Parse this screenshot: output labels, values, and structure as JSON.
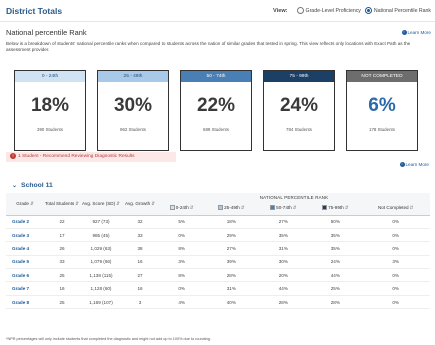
{
  "header": {
    "title": "District Totals",
    "view_label": "View:",
    "view_options": [
      {
        "label": "Grade-Level Proficiency",
        "selected": false
      },
      {
        "label": "National Percentile Rank",
        "selected": true
      }
    ]
  },
  "section": {
    "title": "National percentile Rank",
    "learn_more": "Learn More",
    "description": "Below is a breakdown of students' national percentile ranks when compared to students across the nation of similar grades that tested in spring. This view reflects only locations with Exact Path as the assessment provider."
  },
  "cards": [
    {
      "label": "0 - 24th",
      "percent": "18%",
      "count": "390 Students",
      "head_bg": "#cfe3f5",
      "head_color": "#1f4e79",
      "pct_color": "#3a3a3a"
    },
    {
      "label": "25 - 49th",
      "percent": "30%",
      "count": "962 Students",
      "head_bg": "#a9c9e8",
      "head_color": "#1f4e79",
      "pct_color": "#3a3a3a"
    },
    {
      "label": "50 - 74th",
      "percent": "22%",
      "count": "689 Students",
      "head_bg": "#4a7fb5",
      "head_color": "#ffffff",
      "pct_color": "#3a3a3a"
    },
    {
      "label": "75 - 99th",
      "percent": "24%",
      "count": "784 Students",
      "head_bg": "#1c3f66",
      "head_color": "#ffffff",
      "pct_color": "#3a3a3a"
    },
    {
      "label": "NOT COMPLETED",
      "percent": "6%",
      "count": "178 Students",
      "head_bg": "#6d6d6d",
      "head_color": "#ffffff",
      "pct_color": "#2a6aa8"
    }
  ],
  "alert": {
    "text": "1 Student - Recommend Reviewing Diagnostic Results",
    "learn_more": "Learn More"
  },
  "school": {
    "name": "School 11",
    "group_header": "NATIONAL PERCENTILE RANK",
    "columns": [
      "Grade",
      "Total Students",
      "Avg. Score (SD)",
      "Avg. Growth",
      "0-24th",
      "25-49th",
      "50-74th",
      "75-99th",
      "Not Completed"
    ],
    "rows": [
      [
        "Grade 2",
        "22",
        "927 (73)",
        "32",
        "5%",
        "18%",
        "27%",
        "50%",
        "0%"
      ],
      [
        "Grade 3",
        "17",
        "985 (45)",
        "33",
        "0%",
        "29%",
        "35%",
        "35%",
        "0%"
      ],
      [
        "Grade 4",
        "26",
        "1,029 (63)",
        "38",
        "8%",
        "27%",
        "31%",
        "35%",
        "0%"
      ],
      [
        "Grade 5",
        "33",
        "1,079 (66)",
        "16",
        "3%",
        "39%",
        "30%",
        "24%",
        "3%"
      ],
      [
        "Grade 6",
        "25",
        "1,138 (115)",
        "27",
        "8%",
        "28%",
        "20%",
        "44%",
        "0%"
      ],
      [
        "Grade 7",
        "16",
        "1,128 (60)",
        "16",
        "0%",
        "31%",
        "44%",
        "25%",
        "0%"
      ],
      [
        "Grade 8",
        "25",
        "1,169 (107)",
        "3",
        "4%",
        "40%",
        "28%",
        "28%",
        "0%"
      ]
    ]
  },
  "footnote": "*NPR percentages will only include students that completed the diagnostic and might not add up to 100% due to rounding."
}
